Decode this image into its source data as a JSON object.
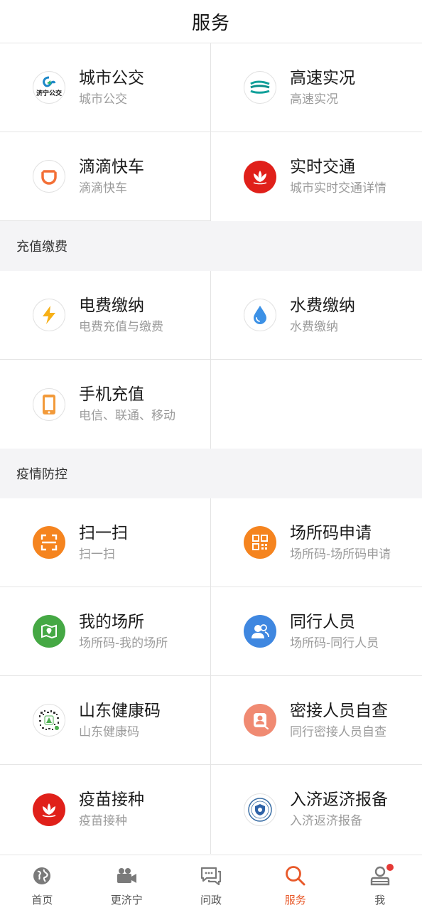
{
  "header": {
    "title": "服务"
  },
  "traffic": [
    {
      "title": "城市公交",
      "sub": "城市公交",
      "icon": "bus-logo-icon"
    },
    {
      "title": "高速实况",
      "sub": "高速实况",
      "icon": "highway-icon"
    },
    {
      "title": "滴滴快车",
      "sub": "滴滴快车",
      "icon": "didi-icon"
    },
    {
      "title": "实时交通",
      "sub": "城市实时交通详情",
      "icon": "lotus-icon"
    }
  ],
  "sections": {
    "recharge": "充值缴费",
    "epidemic": "疫情防控"
  },
  "recharge": [
    {
      "title": "电费缴纳",
      "sub": "电费充值与缴费",
      "icon": "lightning-icon"
    },
    {
      "title": "水费缴纳",
      "sub": "水费缴纳",
      "icon": "water-drop-icon"
    },
    {
      "title": "手机充值",
      "sub": "电信、联通、移动",
      "icon": "phone-icon"
    }
  ],
  "epidemic": [
    {
      "title": "扫一扫",
      "sub": "扫一扫",
      "icon": "scan-icon"
    },
    {
      "title": "场所码申请",
      "sub": "场所码-场所码申请",
      "icon": "qr-code-icon"
    },
    {
      "title": "我的场所",
      "sub": "场所码-我的场所",
      "icon": "map-icon"
    },
    {
      "title": "同行人员",
      "sub": "场所码-同行人员",
      "icon": "people-icon"
    },
    {
      "title": "山东健康码",
      "sub": "山东健康码",
      "icon": "health-qr-icon"
    },
    {
      "title": "密接人员自查",
      "sub": "同行密接人员自查",
      "icon": "person-check-icon"
    },
    {
      "title": "疫苗接种",
      "sub": "疫苗接种",
      "icon": "vaccine-lotus-icon"
    },
    {
      "title": "入济返济报备",
      "sub": "入济返济报备",
      "icon": "badge-shield-icon"
    }
  ],
  "tabs": [
    {
      "label": "首页",
      "icon": "globe-icon",
      "active": false
    },
    {
      "label": "更济宁",
      "icon": "video-camera-icon",
      "active": false
    },
    {
      "label": "问政",
      "icon": "chat-bubbles-icon",
      "active": false
    },
    {
      "label": "服务",
      "icon": "search-icon",
      "active": true
    },
    {
      "label": "我",
      "icon": "user-icon",
      "active": false
    }
  ],
  "colors": {
    "accent": "#e8592a",
    "orange": "#f5841f",
    "red": "#e0201a",
    "green": "#45a844",
    "blue": "#3f87e0",
    "salmon": "#f08a72"
  }
}
